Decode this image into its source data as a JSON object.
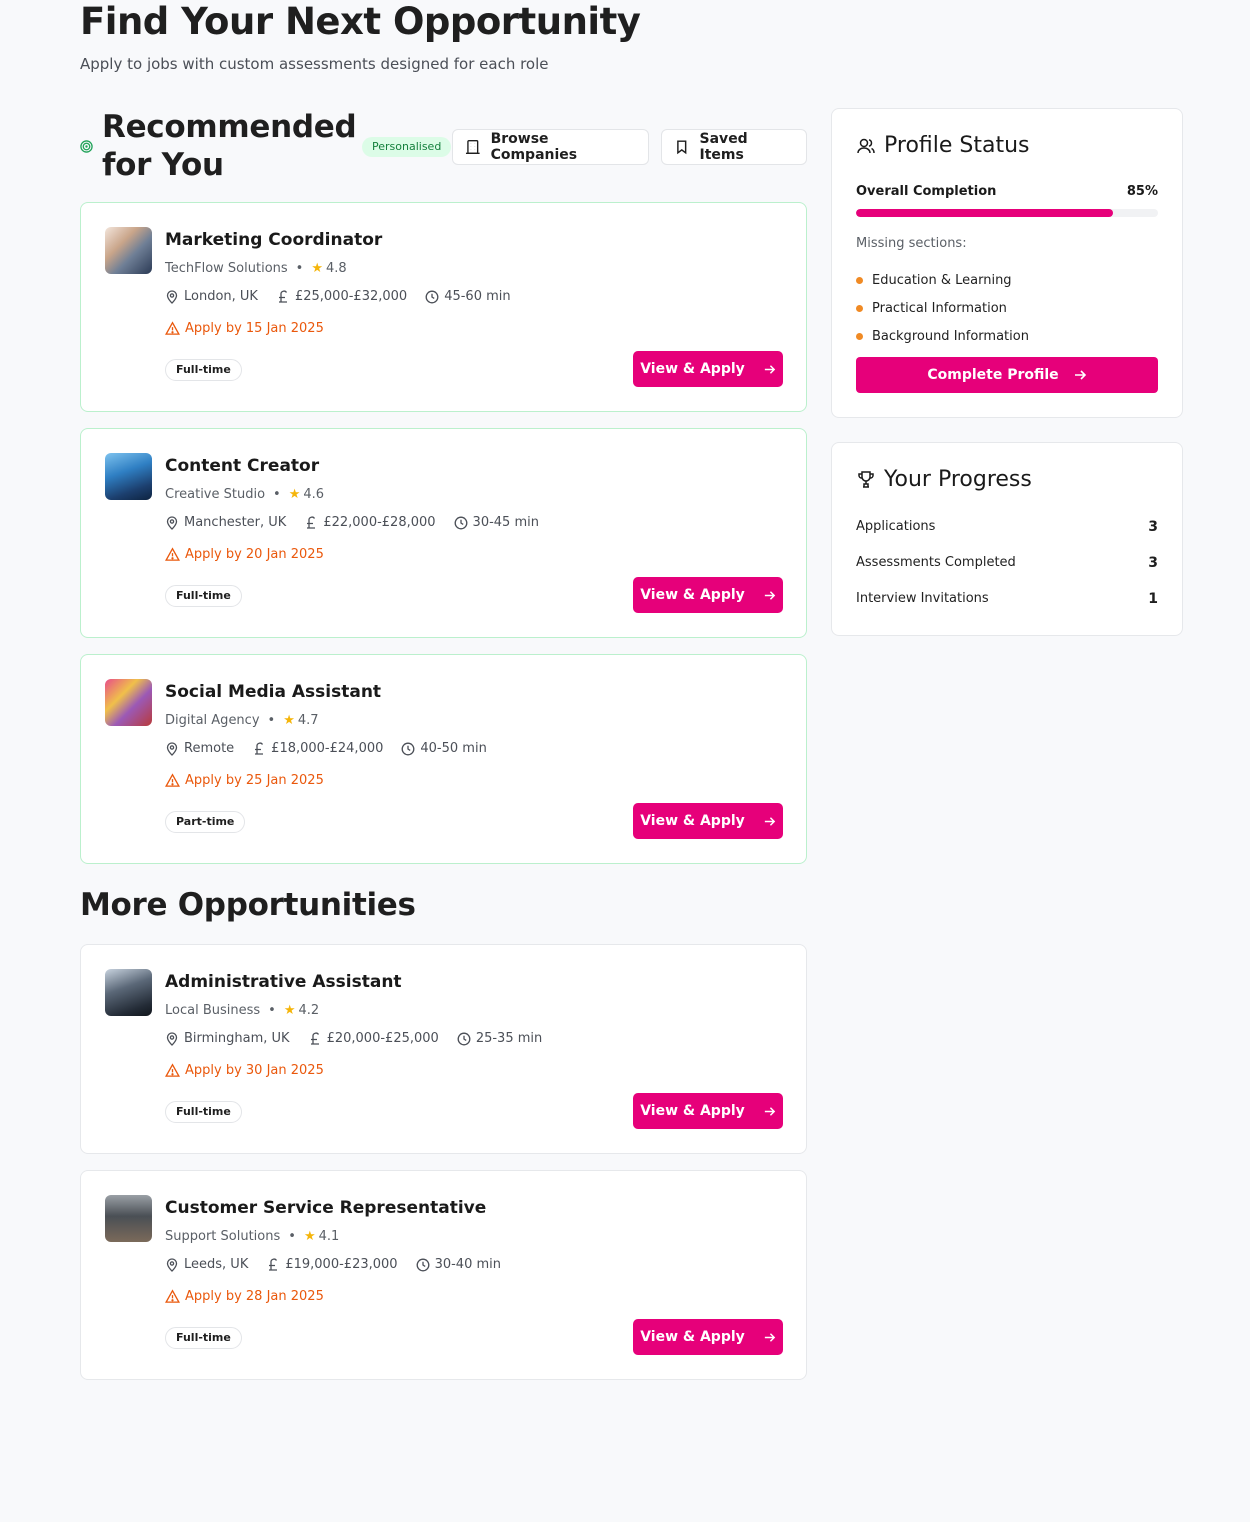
{
  "header": {
    "title": "Find Your Next Opportunity",
    "subtitle": "Apply to jobs with custom assessments designed for each role"
  },
  "recommended": {
    "title": "Recommended for You",
    "badge": "Personalised",
    "browse_label": "Browse Companies",
    "saved_label": "Saved Items",
    "jobs": [
      {
        "title": "Marketing Coordinator",
        "company": "TechFlow Solutions",
        "rating": "4.8",
        "location": "London, UK",
        "salary": "£25,000-£32,000",
        "duration": "45-60 min",
        "deadline": "Apply by 15 Jan 2025",
        "type": "Full-time",
        "apply_label": "View & Apply"
      },
      {
        "title": "Content Creator",
        "company": "Creative Studio",
        "rating": "4.6",
        "location": "Manchester, UK",
        "salary": "£22,000-£28,000",
        "duration": "30-45 min",
        "deadline": "Apply by 20 Jan 2025",
        "type": "Full-time",
        "apply_label": "View & Apply"
      },
      {
        "title": "Social Media Assistant",
        "company": "Digital Agency",
        "rating": "4.7",
        "location": "Remote",
        "salary": "£18,000-£24,000",
        "duration": "40-50 min",
        "deadline": "Apply by 25 Jan 2025",
        "type": "Part-time",
        "apply_label": "View & Apply"
      }
    ]
  },
  "more": {
    "title": "More Opportunities",
    "jobs": [
      {
        "title": "Administrative Assistant",
        "company": "Local Business",
        "rating": "4.2",
        "location": "Birmingham, UK",
        "salary": "£20,000-£25,000",
        "duration": "25-35 min",
        "deadline": "Apply by 30 Jan 2025",
        "type": "Full-time",
        "apply_label": "View & Apply"
      },
      {
        "title": "Customer Service Representative",
        "company": "Support Solutions",
        "rating": "4.1",
        "location": "Leeds, UK",
        "salary": "£19,000-£23,000",
        "duration": "30-40 min",
        "deadline": "Apply by 28 Jan 2025",
        "type": "Full-time",
        "apply_label": "View & Apply"
      }
    ]
  },
  "profile": {
    "title": "Profile Status",
    "completion_label": "Overall Completion",
    "completion_value": "85%",
    "completion_fraction": 0.85,
    "missing_label": "Missing sections:",
    "missing": [
      "Education & Learning",
      "Practical Information",
      "Background Information"
    ],
    "button_label": "Complete Profile"
  },
  "progress": {
    "title": "Your Progress",
    "stats": [
      {
        "label": "Applications",
        "value": "3"
      },
      {
        "label": "Assessments Completed",
        "value": "3"
      },
      {
        "label": "Interview Invitations",
        "value": "1"
      }
    ]
  },
  "colors": {
    "accent": "#e6007a",
    "deadline": "#ea580c",
    "recommended_border": "#bbf0cd",
    "badge_bg": "#dcfce7",
    "badge_text": "#15803d",
    "missing_dot": "#f08a24",
    "star": "#f5b50a"
  }
}
